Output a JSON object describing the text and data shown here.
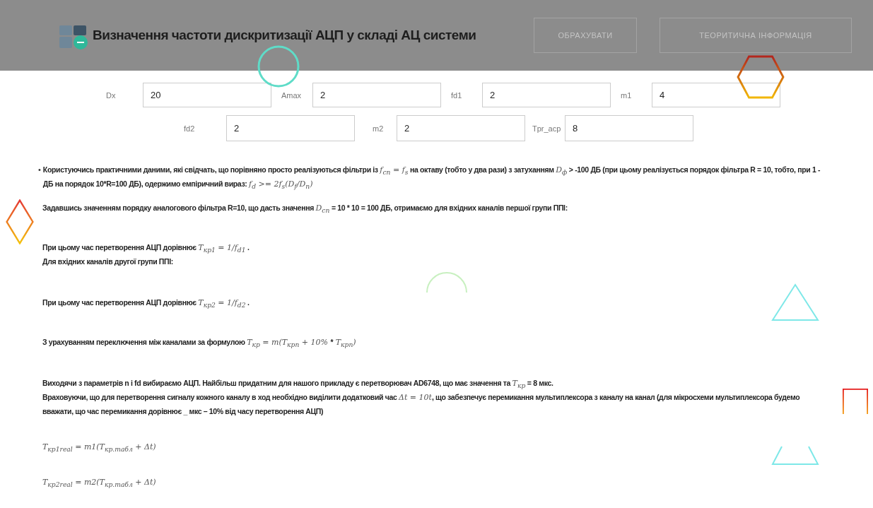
{
  "header": {
    "title": "Визначення частоти дискритизації АЦП у складі АЦ системи",
    "buttons": [
      "ОБРАХУВАТИ",
      "ТЕОРИТИЧНА ІНФОРМАЦІЯ"
    ]
  },
  "fields": [
    [
      {
        "label": "Dx",
        "value": "20"
      },
      {
        "label": "Amax",
        "value": "2"
      },
      {
        "label": "fd1",
        "value": "2"
      },
      {
        "label": "m1",
        "value": "4"
      }
    ],
    [
      {
        "label": "fd2",
        "value": "2"
      },
      {
        "label": "m2",
        "value": "2"
      },
      {
        "label": "Tpr_acp",
        "value": "8"
      }
    ]
  ],
  "blocks": [
    {
      "bullet": "•",
      "lines": [
        [
          {
            "kind": "text",
            "text": "Користуючись практичними даними, які свідчать, що порівняно просто реалізуються фільтри із "
          },
          {
            "kind": "math",
            "text": "f$_{сп}$ = f$_{s}$"
          },
          {
            "kind": "text",
            "text": " на октаву (тобто у два рази) з затуханням "
          },
          {
            "kind": "math",
            "text": "D$_{ф}$"
          },
          {
            "kind": "text",
            "text": " > -100 ДБ (при цьому реалізується порядок фільтра R = 10, тобто, при 1 - ДБ на порядок 10*R=100 ДБ), одержимо емпіричний вираз: "
          },
          {
            "kind": "math",
            "text": "f$_{d}$ >= 2f$_{s}$(D$_{f}$/D$_{n}$)"
          }
        ]
      ]
    },
    {
      "lines": [
        [
          {
            "kind": "text",
            "text": "Задавшись значенням порядку аналогового фільтра R=10, що дасть значення "
          },
          {
            "kind": "math",
            "text": "D$_{сп}$"
          },
          {
            "kind": "text",
            "text": " = 10 * 10 = 100 ДБ, отримаємо для вхідних каналів першої групи ППІ:"
          }
        ]
      ]
    },
    {
      "lines": [
        [
          {
            "kind": "text",
            "text": "При цьому час перетворення АЦП дорівнює "
          },
          {
            "kind": "math",
            "text": "T$_{кр1}$ = 1/f$_{d1}$"
          },
          {
            "kind": "text",
            "text": " ."
          }
        ],
        [
          {
            "kind": "text",
            "text": "Для вхідних каналів другої групи ППІ:"
          }
        ]
      ]
    },
    {
      "lines": [
        [
          {
            "kind": "text",
            "text": "При цьому час перетворення АЦП дорівнює "
          },
          {
            "kind": "math",
            "text": "T$_{кр2}$ = 1/f$_{d2}$"
          },
          {
            "kind": "text",
            "text": " ."
          }
        ]
      ]
    },
    {
      "lines": [
        [
          {
            "kind": "text",
            "text": "З урахуванням переключення між каналами за формулою "
          },
          {
            "kind": "math",
            "text": "T$_{кр}$ = m(T$_{крn}$ + 10% "
          },
          {
            "kind": "text",
            "text": "*"
          },
          {
            "kind": "math",
            "text": " T$_{крn}$)"
          }
        ]
      ]
    },
    {
      "lines": [
        [
          {
            "kind": "text",
            "text": "Виходячи з параметрів n і fd вибираємо АЦП. Найбільш придатним для нашого прикладу є перетворювач AD6748, що має значення та "
          },
          {
            "kind": "math",
            "text": "T$_{кр}$"
          },
          {
            "kind": "text",
            "text": " = 8 мкс."
          }
        ],
        [
          {
            "kind": "text",
            "text": "Враховуючи, що для перетворення сигналу кожного каналу в ход необхідно виділити додатковий час "
          },
          {
            "kind": "math",
            "text": "Δt = 10t"
          },
          {
            "kind": "text",
            "text": ", що забезпечує перемикання мультиплексора з каналу на канал (для мікросхеми мультиплексора будемо вважати, що час перемикання дорівнює _ мкс – 10% від часу перетворення АЦП)"
          }
        ]
      ]
    },
    {
      "lines": [
        [
          {
            "kind": "math",
            "text": "T$_{кр1real}$ = m1(T$_{кр.табл}$ + Δt)"
          }
        ]
      ]
    },
    {
      "lines": [
        [
          {
            "kind": "math",
            "text": "T$_{кр2real}$ = m2(T$_{кр.табл}$ + Δt)"
          }
        ]
      ]
    }
  ]
}
